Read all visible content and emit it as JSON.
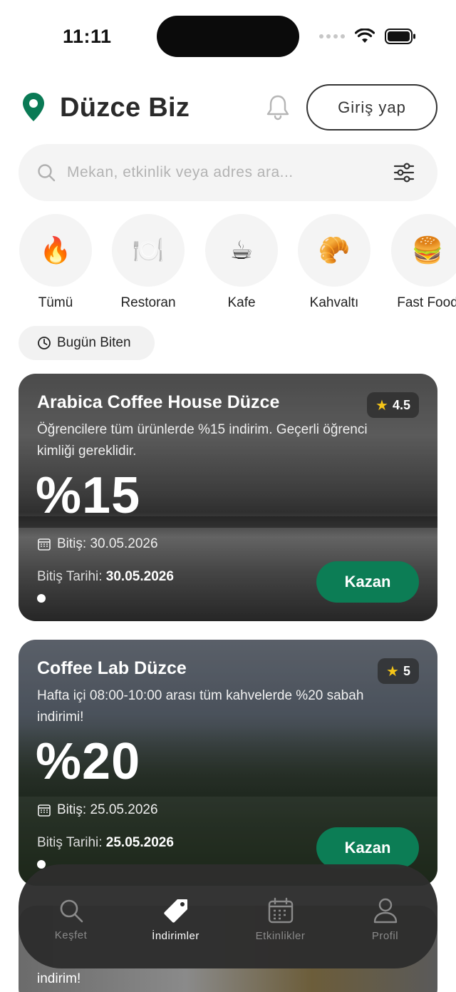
{
  "status_bar": {
    "time": "11:11"
  },
  "header": {
    "title": "Düzce Biz",
    "login_label": "Giriş yap"
  },
  "search": {
    "placeholder": "Mekan, etkinlik veya adres ara..."
  },
  "categories": [
    {
      "label": "Tümü",
      "icon": "🔥"
    },
    {
      "label": "Restoran",
      "icon": "🍽️"
    },
    {
      "label": "Kafe",
      "icon": "☕"
    },
    {
      "label": "Kahvaltı",
      "icon": "🥐"
    },
    {
      "label": "Fast Food",
      "icon": "🍔"
    }
  ],
  "filter_chip": {
    "label": "Bugün Biten"
  },
  "deals": [
    {
      "name": "Arabica Coffee House Düzce",
      "rating": "4.5",
      "description": "Öğrencilere tüm ürünlerde %15 indirim. Geçerli öğrenci kimliği gereklidir.",
      "discount": "%15",
      "end_short": "Bitiş: 30.05.2026",
      "end_label": "Bitiş Tarihi:",
      "end_date": "30.05.2026",
      "cta": "Kazan"
    },
    {
      "name": "Coffee Lab Düzce",
      "rating": "5",
      "description": "Hafta içi 08:00-10:00 arası tüm kahvelerde %20 sabah indirimi!",
      "discount": "%20",
      "end_short": "Bitiş: 25.05.2026",
      "end_label": "Bitiş Tarihi:",
      "end_date": "25.05.2026",
      "cta": "Kazan"
    }
  ],
  "peek_card": {
    "text": "indirim!"
  },
  "nav": [
    {
      "label": "Keşfet",
      "active": false
    },
    {
      "label": "İndirimler",
      "active": true
    },
    {
      "label": "Etkinlikler",
      "active": false
    },
    {
      "label": "Profil",
      "active": false
    }
  ],
  "colors": {
    "brand_green": "#0c7d55",
    "pin_green": "#0a7a55",
    "star": "#f5c518"
  }
}
